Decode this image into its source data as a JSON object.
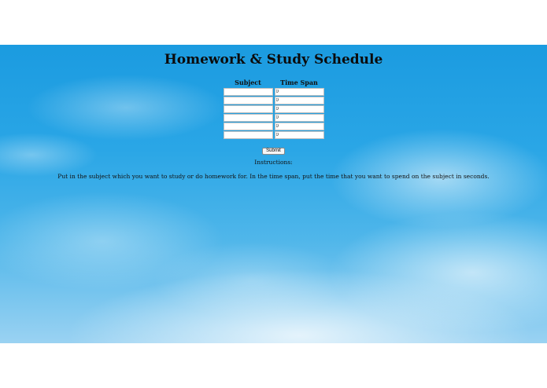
{
  "page": {
    "title": "Homework & Study Schedule"
  },
  "schedule": {
    "headers": {
      "subject": "Subject",
      "time_span": "Time Span"
    },
    "rows": [
      {
        "subject": "",
        "time_span": "0"
      },
      {
        "subject": "",
        "time_span": "0"
      },
      {
        "subject": "",
        "time_span": "0"
      },
      {
        "subject": "",
        "time_span": "0"
      },
      {
        "subject": "",
        "time_span": "0"
      },
      {
        "subject": "",
        "time_span": "0"
      }
    ],
    "submit_label": "Submit"
  },
  "instructions": {
    "heading": "Instructions:",
    "text": "Put in the subject which you want to study or do homework for. In the time span, put the time that you want to spend on the subject in seconds."
  },
  "colors": {
    "sky": "#2aa6e6",
    "text": "#111111"
  }
}
